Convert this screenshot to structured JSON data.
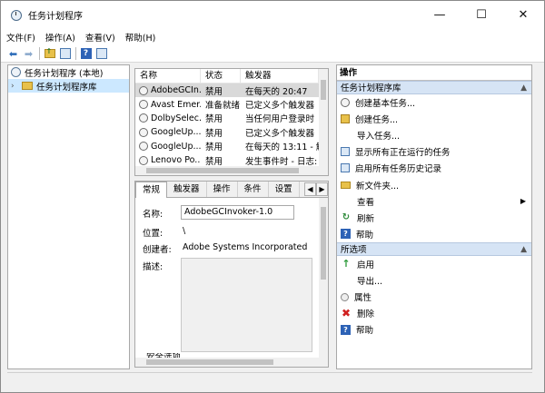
{
  "window": {
    "title": "任务计划程序",
    "controls": {
      "minimize": "—",
      "maximize": "☐",
      "close": "✕"
    }
  },
  "menu": [
    "文件(F)",
    "操作(A)",
    "查看(V)",
    "帮助(H)"
  ],
  "toolbar": {
    "icons": [
      "back-arrow-icon",
      "forward-arrow-icon",
      "up-folder-icon",
      "show-hide-pane-icon",
      "help-icon",
      "properties-pane-icon"
    ]
  },
  "tree": {
    "root": "任务计划程序 (本地)",
    "child": "任务计划程序库"
  },
  "task_list": {
    "columns": [
      "名称",
      "状态",
      "触发器"
    ],
    "rows": [
      {
        "name": "AdobeGCIn...",
        "status": "禁用",
        "trigger": "在每天的 20:47"
      },
      {
        "name": "Avast Emer...",
        "status": "准备就绪",
        "trigger": "已定义多个触发器"
      },
      {
        "name": "DolbySelec...",
        "status": "禁用",
        "trigger": "当任何用户登录时"
      },
      {
        "name": "GoogleUp...",
        "status": "禁用",
        "trigger": "已定义多个触发器"
      },
      {
        "name": "GoogleUp...",
        "status": "禁用",
        "trigger": "在每天的 13:11 - 触"
      },
      {
        "name": "Lenovo Po...",
        "status": "禁用",
        "trigger": "发生事件时 - 日志:"
      }
    ]
  },
  "details": {
    "tabs": [
      "常规",
      "触发器",
      "操作",
      "条件",
      "设置"
    ],
    "name_label": "名称:",
    "name_value": "AdobeGCInvoker-1.0",
    "location_label": "位置:",
    "location_value": "\\",
    "author_label": "创建者:",
    "author_value": "Adobe Systems Incorporated",
    "description_label": "描述:",
    "security_label": "安全选项"
  },
  "actions": {
    "title": "操作",
    "section1": {
      "header": "任务计划程序库",
      "items": [
        {
          "label": "创建基本任务...",
          "icon": "create-basic-task-icon"
        },
        {
          "label": "创建任务...",
          "icon": "create-task-icon"
        },
        {
          "label": "导入任务...",
          "icon": "blank"
        },
        {
          "label": "显示所有正在运行的任务",
          "icon": "running-tasks-icon"
        },
        {
          "label": "启用所有任务历史记录",
          "icon": "history-icon"
        },
        {
          "label": "新文件夹...",
          "icon": "new-folder-icon"
        },
        {
          "label": "查看",
          "icon": "blank",
          "submenu": true
        },
        {
          "label": "刷新",
          "icon": "refresh-icon"
        },
        {
          "label": "帮助",
          "icon": "help-icon"
        }
      ]
    },
    "section2": {
      "header": "所选项",
      "items": [
        {
          "label": "启用",
          "icon": "enable-icon"
        },
        {
          "label": "导出...",
          "icon": "blank"
        },
        {
          "label": "属性",
          "icon": "properties-icon"
        },
        {
          "label": "删除",
          "icon": "delete-icon"
        },
        {
          "label": "帮助",
          "icon": "help-icon"
        }
      ]
    }
  }
}
